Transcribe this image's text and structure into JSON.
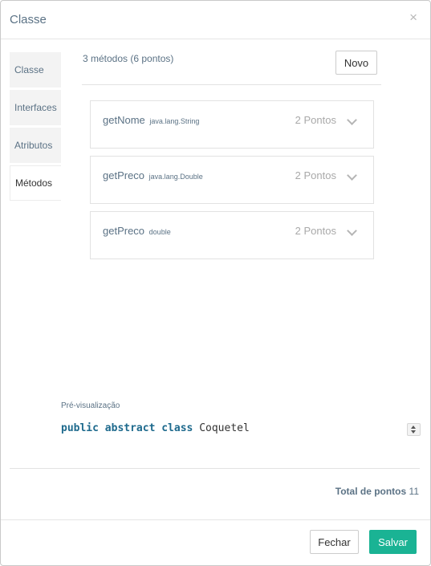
{
  "modal": {
    "title": "Classe",
    "close_symbol": "×"
  },
  "tabs": [
    {
      "label": "Classe",
      "active": false
    },
    {
      "label": "Interfaces",
      "active": false
    },
    {
      "label": "Atributos",
      "active": false
    },
    {
      "label": "Métodos",
      "active": true
    }
  ],
  "methods_panel": {
    "count_text": "3 métodos (6 pontos)",
    "new_button_label": "Novo",
    "methods": [
      {
        "name": "getNome",
        "type": "java.lang.String",
        "points": "2 Pontos",
        "expand_icon": "chevron-down-icon"
      },
      {
        "name": "getPreco",
        "type": "java.lang.Double",
        "points": "2 Pontos",
        "expand_icon": "chevron-down-icon"
      },
      {
        "name": "getPreco",
        "type": "double",
        "points": "2 Pontos",
        "expand_icon": "chevron-down-icon"
      }
    ]
  },
  "preview": {
    "label": "Pré-visualização",
    "code_keywords": "public abstract class",
    "code_name": "Coquetel"
  },
  "total": {
    "label": "Total de pontos",
    "value": "11"
  },
  "footer": {
    "close_label": "Fechar",
    "save_label": "Salvar"
  },
  "colors": {
    "accent": "#1ab394",
    "label_text": "#5b7285",
    "keyword": "#1e6a8d"
  }
}
